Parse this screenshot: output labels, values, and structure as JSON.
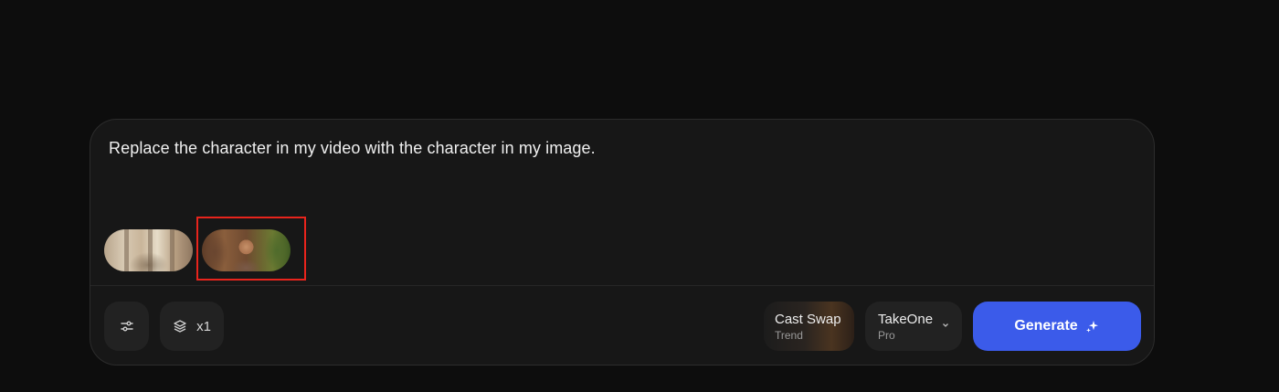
{
  "composer": {
    "prompt_text": "Replace the character in my video with the character in my image."
  },
  "attachments": [
    {
      "kind": "scene"
    },
    {
      "kind": "person",
      "highlighted": true
    }
  ],
  "toolbar": {
    "settings_icon": "sliders-icon",
    "count_icon": "layers-icon",
    "count_label": "x1",
    "style": {
      "title": "Cast Swap",
      "subtitle": "Trend"
    },
    "model": {
      "title": "TakeOne",
      "subtitle": "Pro",
      "chevron_icon": "chevron-down-icon"
    },
    "generate_label": "Generate",
    "generate_icon": "sparkle-icon"
  },
  "colors": {
    "background": "#0d0d0d",
    "panel": "#171717",
    "accent": "#3b5bea",
    "highlight": "#e8241c"
  }
}
